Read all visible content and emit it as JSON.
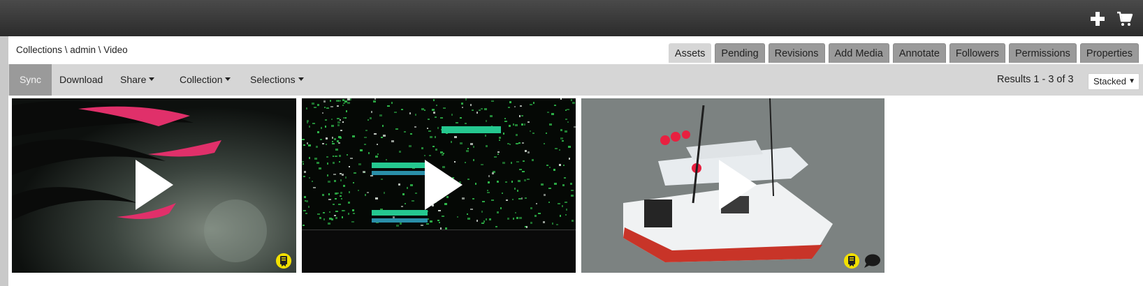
{
  "top_icons": [
    "plus-icon",
    "cart-icon"
  ],
  "breadcrumb": "Collections \\ admin \\ Video",
  "tabs": [
    "Assets",
    "Pending",
    "Revisions",
    "Add Media",
    "Annotate",
    "Followers",
    "Permissions",
    "Properties"
  ],
  "active_tab": "Assets",
  "toolbar": {
    "sync": "Sync",
    "download": "Download",
    "share": "Share",
    "collection": "Collection",
    "selections": "Selections"
  },
  "results": "Results 1 - 3 of 3",
  "view_mode": "Stacked",
  "colors": {
    "topbar": "#333333",
    "tab_inactive": "#9a9a9a",
    "tab_active": "#d6d6d6",
    "toolbar": "#d6d6d6",
    "sync_active": "#9a9a9a",
    "badge_yellow": "#f2e000"
  },
  "assets": [
    {
      "badges": [
        "certificate-icon"
      ]
    },
    {
      "badges": []
    },
    {
      "badges": [
        "certificate-icon",
        "comment-icon"
      ]
    }
  ]
}
